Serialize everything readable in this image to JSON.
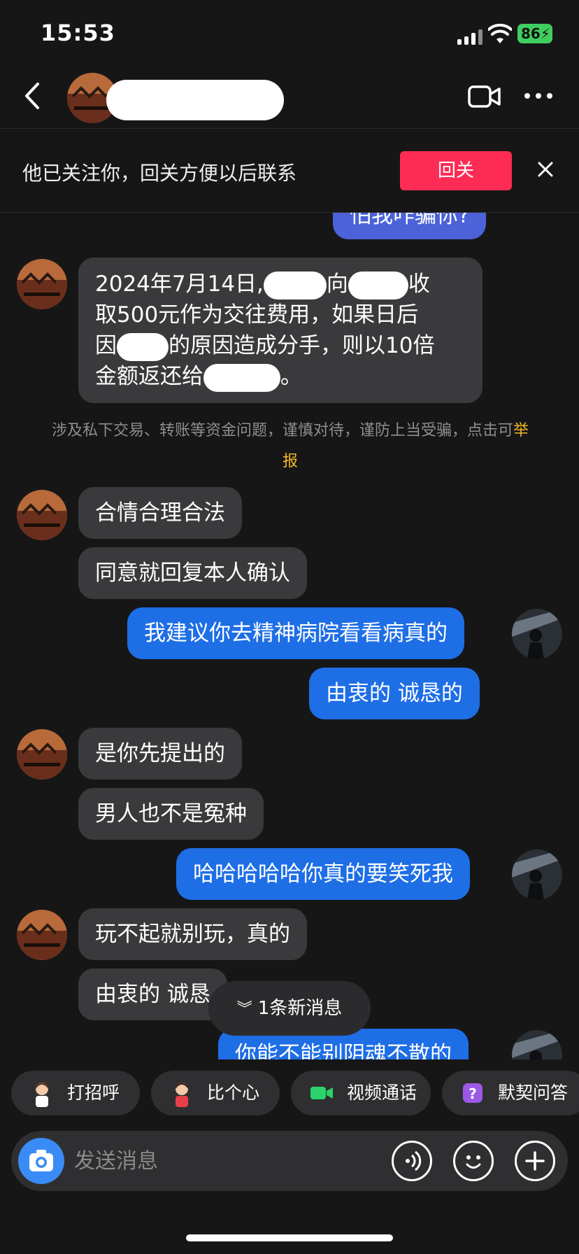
{
  "status_bar": {
    "time": "15:53",
    "battery": "86"
  },
  "header": {
    "back_icon": "chevron-left-icon",
    "video_icon": "video-camera-icon",
    "more_icon": "ellipsis-icon"
  },
  "follow_banner": {
    "text": "他已关注你，回关方便以后联系",
    "button_label": "回关",
    "button_color": "#fe2c55"
  },
  "messages": {
    "m0": "怕我咋骗你?",
    "m1_line1_a": "2024年7月14日,",
    "m1_line1_b": "向",
    "m1_line1_c": "收",
    "m1_line2": "取500元作为交往费用，如果日后",
    "m1_line3_a": "因",
    "m1_line3_b": "的原因造成分手，则以10倍",
    "m1_line4_a": "金额返还给",
    "m1_line4_b": "。",
    "m2": "合情合理合法",
    "m3": "同意就回复本人确认",
    "m4": "我建议你去精神病院看看病真的",
    "m5": "由衷的 诚恳的",
    "m6": "是你先提出的",
    "m7": "男人也不是冤种",
    "m8": "哈哈哈哈哈你真的要笑死我",
    "m9": "玩不起就别玩，真的",
    "m10": "由衷的 诚恳",
    "m11": "你能不能别阴魂不散的"
  },
  "warning": {
    "text": "涉及私下交易、转账等资金问题，谨慎对待，谨防上当受骗，点击可",
    "report_link": "举报"
  },
  "new_message_pill": "1条新消息",
  "quick_actions": [
    {
      "label": "打招呼",
      "icon": "wave-hello-icon"
    },
    {
      "label": "比个心",
      "icon": "heart-gesture-icon"
    },
    {
      "label": "视频通话",
      "icon": "video-call-icon"
    },
    {
      "label": "默契问答",
      "icon": "question-box-icon"
    }
  ],
  "input": {
    "placeholder": "发送消息",
    "camera_icon": "camera-icon",
    "voice_icon": "voice-icon",
    "emoji_icon": "emoji-icon",
    "plus_icon": "plus-icon"
  },
  "colors": {
    "incoming_bubble": "#3a3a3c",
    "outgoing_bubble": "#1e6ee6",
    "background": "#161616"
  }
}
